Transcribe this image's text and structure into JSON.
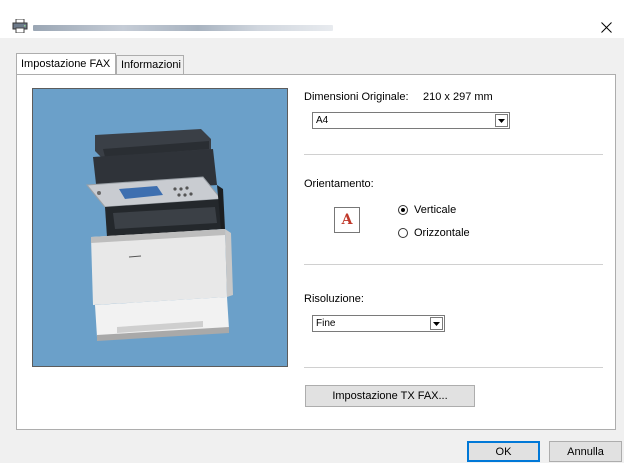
{
  "window": {
    "close_symbol": "✕"
  },
  "tabs": [
    {
      "label": "Impostazione FAX",
      "active": true
    },
    {
      "label": "Informazioni",
      "active": false
    }
  ],
  "original_size": {
    "label": "Dimensioni Originale:",
    "dimensions": "210 x 297 mm",
    "selected": "A4"
  },
  "orientation": {
    "label": "Orientamento:",
    "icon_letter": "A",
    "options": [
      {
        "label": "Verticale",
        "selected": true
      },
      {
        "label": "Orizzontale",
        "selected": false
      }
    ]
  },
  "resolution": {
    "label": "Risoluzione:",
    "selected": "Fine"
  },
  "buttons": {
    "tx_settings": "Impostazione TX FAX...",
    "ok": "OK",
    "cancel": "Annulla"
  },
  "colors": {
    "preview_bg": "#6ba0c9",
    "accent": "#0078d7",
    "orientation_letter": "#c0392b"
  }
}
